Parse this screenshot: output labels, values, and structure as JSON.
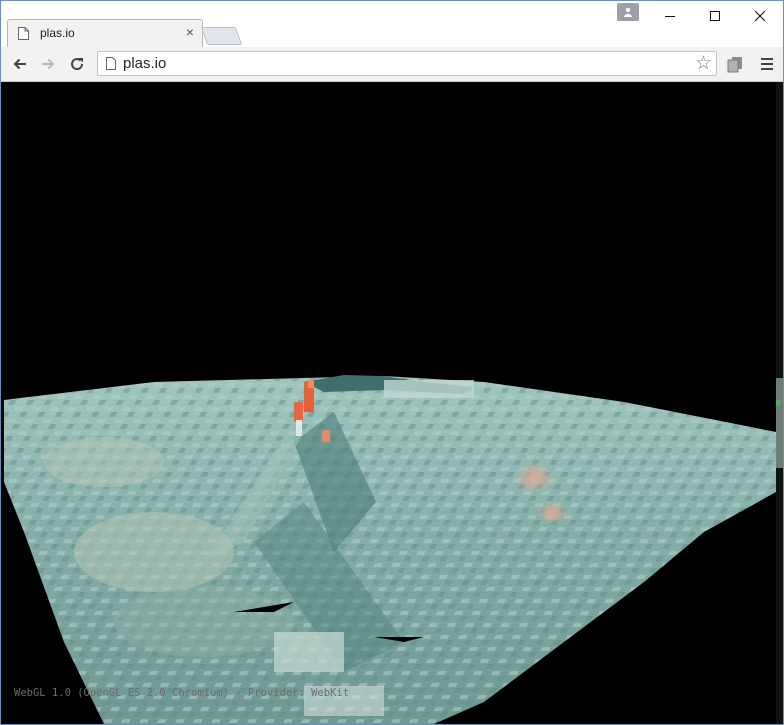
{
  "browser": {
    "tab_title": "plas.io",
    "tab_close": "×",
    "url": "plas.io",
    "bookmark_star": "☆",
    "icons": {
      "page": "page-icon",
      "back": "back-arrow-icon",
      "forward": "forward-arrow-icon",
      "reload": "reload-icon",
      "star": "star-icon",
      "extension": "extension-icon",
      "menu": "hamburger-menu-icon",
      "profile": "profile-icon",
      "minimize": "minimize-icon",
      "maximize": "maximize-icon",
      "close": "close-icon"
    }
  },
  "viewport": {
    "renderer_info": "WebGL 1.0 (OpenGL ES 2.0 Chromium) - Provider: WebKit"
  },
  "colors": {
    "point_cloud_base": "#8fb7b0",
    "point_cloud_highlight": "#e0603a",
    "background": "#000000",
    "window_border": "#6b8fb5"
  }
}
